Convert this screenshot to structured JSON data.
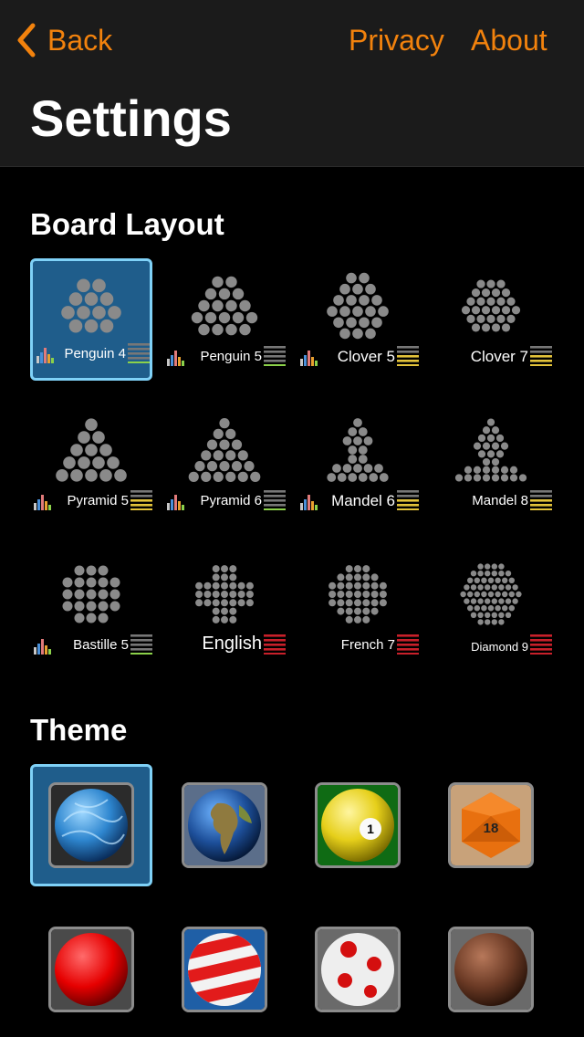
{
  "nav": {
    "back_label": "Back",
    "privacy_label": "Privacy",
    "about_label": "About",
    "title": "Settings"
  },
  "colors": {
    "accent": "#f2820d",
    "selection_fill": "#1f5d8b",
    "selection_border": "#7fd1f7",
    "peg": "#8a8a8a",
    "difficulty_easy": "#8bd14a",
    "difficulty_medium": "#e3c33a",
    "difficulty_hard": "#c8202a",
    "difficulty_off": "#777777"
  },
  "board_section_title": "Board Layout",
  "boards": [
    {
      "name": "Penguin 4",
      "stats_icon": true,
      "difficulty": "easy",
      "selected": true
    },
    {
      "name": "Penguin 5",
      "stats_icon": true,
      "difficulty": "easy",
      "selected": false
    },
    {
      "name": "Clover 5",
      "stats_icon": true,
      "difficulty": "medium",
      "selected": false
    },
    {
      "name": "Clover 7",
      "stats_icon": false,
      "difficulty": "medium",
      "selected": false
    },
    {
      "name": "Pyramid 5",
      "stats_icon": true,
      "difficulty": "medium",
      "selected": false
    },
    {
      "name": "Pyramid 6",
      "stats_icon": true,
      "difficulty": "easy",
      "selected": false
    },
    {
      "name": "Mandel 6",
      "stats_icon": true,
      "difficulty": "medium",
      "selected": false
    },
    {
      "name": "Mandel 8",
      "stats_icon": false,
      "difficulty": "medium",
      "selected": false
    },
    {
      "name": "Bastille 5",
      "stats_icon": true,
      "difficulty": "easy",
      "selected": false
    },
    {
      "name": "English",
      "stats_icon": false,
      "difficulty": "hard",
      "selected": false
    },
    {
      "name": "French 7",
      "stats_icon": false,
      "difficulty": "hard",
      "selected": false
    },
    {
      "name": "Diamond 9",
      "stats_icon": false,
      "difficulty": "hard",
      "selected": false
    }
  ],
  "theme_section_title": "Theme",
  "themes": [
    {
      "name": "blue-marble",
      "selected": true
    },
    {
      "name": "earth",
      "selected": false
    },
    {
      "name": "billiard-ball",
      "selected": false
    },
    {
      "name": "d20-die",
      "selected": false
    },
    {
      "name": "red-ball",
      "selected": false
    },
    {
      "name": "striped-ball",
      "selected": false
    },
    {
      "name": "spotted-ball",
      "selected": false
    },
    {
      "name": "wood-ball",
      "selected": false
    }
  ]
}
